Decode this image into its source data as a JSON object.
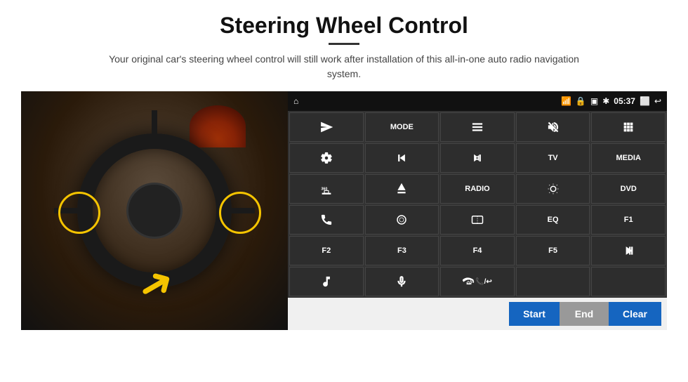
{
  "page": {
    "title": "Steering Wheel Control",
    "subtitle": "Your original car's steering wheel control will still work after installation of this all-in-one auto radio navigation system.",
    "title_underline": true
  },
  "status_bar": {
    "wifi_icon": "wifi",
    "lock_icon": "lock",
    "sd_icon": "sd",
    "bt_icon": "bluetooth",
    "time": "05:37",
    "screen_icon": "screen",
    "back_icon": "back",
    "home_icon": "home"
  },
  "grid_buttons": [
    {
      "id": "send",
      "type": "icon",
      "icon": "send"
    },
    {
      "id": "mode",
      "type": "text",
      "label": "MODE"
    },
    {
      "id": "list",
      "type": "icon",
      "icon": "list"
    },
    {
      "id": "mute",
      "type": "icon",
      "icon": "mute"
    },
    {
      "id": "apps",
      "type": "icon",
      "icon": "apps"
    },
    {
      "id": "settings",
      "type": "icon",
      "icon": "settings"
    },
    {
      "id": "prev",
      "type": "icon",
      "icon": "prev"
    },
    {
      "id": "next",
      "type": "icon",
      "icon": "next"
    },
    {
      "id": "tv",
      "type": "text",
      "label": "TV"
    },
    {
      "id": "media",
      "type": "text",
      "label": "MEDIA"
    },
    {
      "id": "cam360",
      "type": "icon",
      "icon": "cam360"
    },
    {
      "id": "eject",
      "type": "icon",
      "icon": "eject"
    },
    {
      "id": "radio",
      "type": "text",
      "label": "RADIO"
    },
    {
      "id": "bright",
      "type": "icon",
      "icon": "brightness"
    },
    {
      "id": "dvd",
      "type": "text",
      "label": "DVD"
    },
    {
      "id": "phone",
      "type": "icon",
      "icon": "phone"
    },
    {
      "id": "swipe",
      "type": "icon",
      "icon": "swipe"
    },
    {
      "id": "mirror",
      "type": "icon",
      "icon": "mirror"
    },
    {
      "id": "eq",
      "type": "text",
      "label": "EQ"
    },
    {
      "id": "f1",
      "type": "text",
      "label": "F1"
    },
    {
      "id": "f2",
      "type": "text",
      "label": "F2"
    },
    {
      "id": "f3",
      "type": "text",
      "label": "F3"
    },
    {
      "id": "f4",
      "type": "text",
      "label": "F4"
    },
    {
      "id": "f5",
      "type": "text",
      "label": "F5"
    },
    {
      "id": "playpause",
      "type": "icon",
      "icon": "playpause"
    },
    {
      "id": "music",
      "type": "icon",
      "icon": "music"
    },
    {
      "id": "mic",
      "type": "icon",
      "icon": "mic"
    },
    {
      "id": "hangup",
      "type": "icon",
      "icon": "hangup"
    },
    {
      "id": "empty1",
      "type": "empty"
    },
    {
      "id": "empty2",
      "type": "empty"
    }
  ],
  "bottom_buttons": {
    "start": "Start",
    "end": "End",
    "clear": "Clear"
  }
}
